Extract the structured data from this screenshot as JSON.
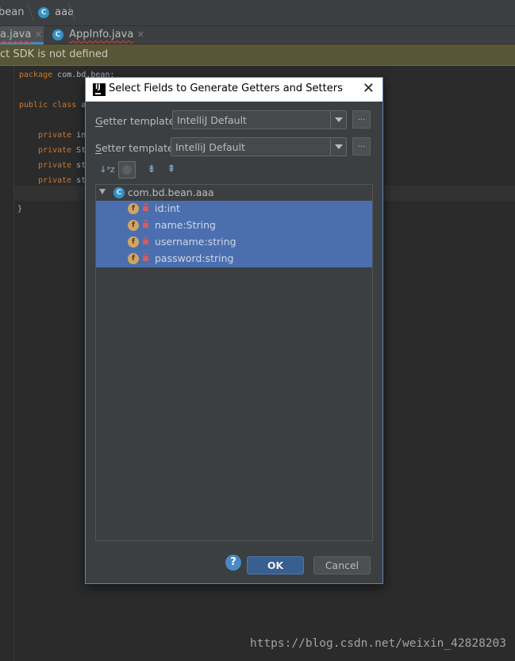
{
  "breadcrumb": {
    "item1": "bean",
    "item2": "aaa",
    "class_icon": "C"
  },
  "tabs": [
    {
      "label": "a.java",
      "close": "×"
    },
    {
      "label": "AppInfo.java",
      "close": "×"
    }
  ],
  "warning": {
    "text": "ct SDK is not defined"
  },
  "editor": {
    "line_package_kw": "package",
    "line_package_rest": " com.bd.bean;",
    "line_class_kw": "public class",
    "line_class_rest": " a",
    "fields": [
      {
        "kw": "private",
        "rest": " in"
      },
      {
        "kw": "private",
        "rest": " St"
      },
      {
        "kw": "private",
        "rest": " st"
      },
      {
        "kw": "private",
        "rest": " st"
      }
    ],
    "closing_brace": "}"
  },
  "dialog": {
    "title": "Select Fields to Generate Getters and Setters",
    "close": "✕",
    "getter": {
      "mnemonic": "G",
      "label_rest": "etter template:",
      "value": "IntelliJ Default",
      "more": "..."
    },
    "setter": {
      "mnemonic": "S",
      "label_rest": "etter template:",
      "value": "IntelliJ Default",
      "more": "..."
    },
    "toolbar": {
      "sort": "↓ᵃz",
      "expand": "⇟",
      "collapse": "⇞"
    },
    "tree": {
      "root_label": "com.bd.bean.aaa",
      "fields": [
        {
          "icon": "f",
          "label": "id:int"
        },
        {
          "icon": "f",
          "label": "name:String"
        },
        {
          "icon": "f",
          "label": "username:string"
        },
        {
          "icon": "f",
          "label": "password:string"
        }
      ]
    },
    "help": "?",
    "ok": "OK",
    "cancel": "Cancel"
  },
  "watermark": "https://blog.csdn.net/weixin_42828203",
  "colors": {
    "selection": "#4b6eaf",
    "accent": "#4a88c7",
    "keyword": "#cc7832"
  }
}
